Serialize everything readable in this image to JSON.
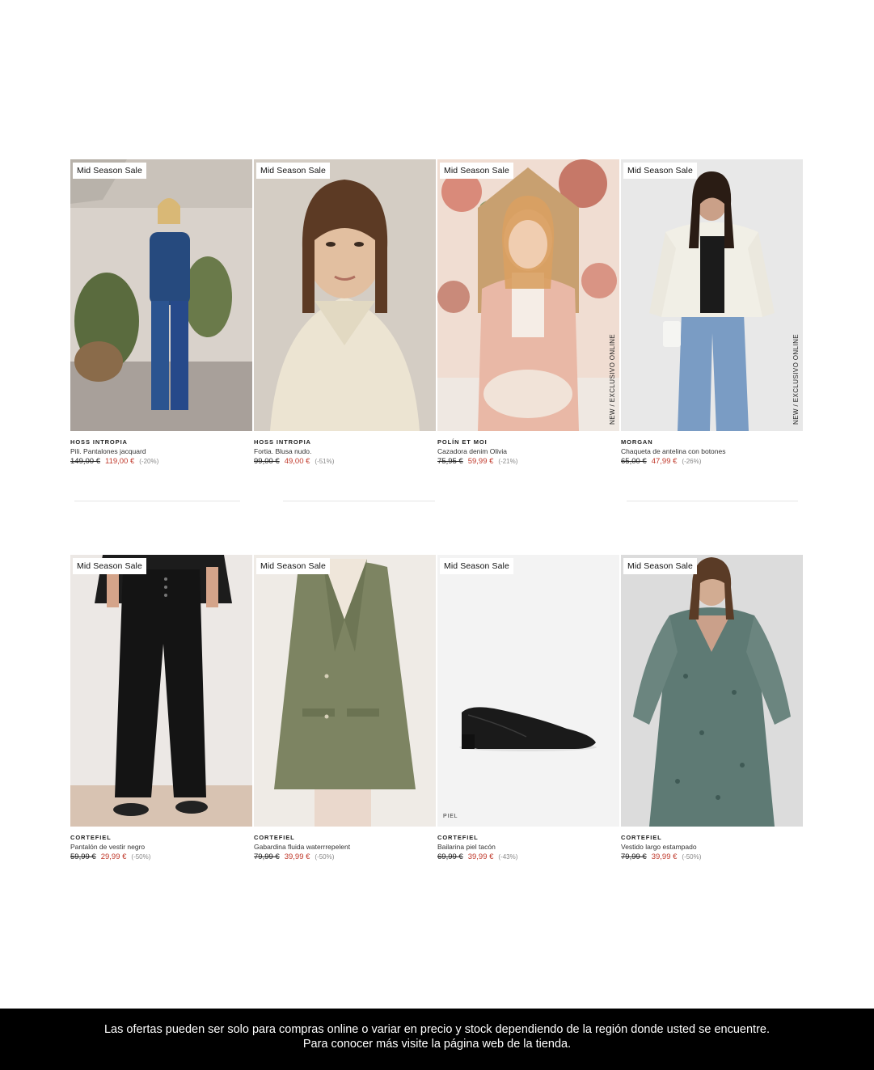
{
  "colors": {
    "sale_price": "#c0392b",
    "discount": "#888888",
    "footer_bg": "#000000",
    "footer_text": "#ffffff"
  },
  "rows": [
    {
      "products": [
        {
          "badge": "Mid Season Sale",
          "brand": "HOSS INTROPIA",
          "name": "Pili. Pantalones jacquard",
          "old_price": "149,00 €",
          "new_price": "119,00 €",
          "discount": "(-20%)",
          "tag": ""
        },
        {
          "badge": "Mid Season Sale",
          "brand": "HOSS INTROPIA",
          "name": "Fortia. Blusa nudo.",
          "old_price": "99,00 €",
          "new_price": "49,00 €",
          "discount": "(-51%)",
          "tag": ""
        },
        {
          "badge": "Mid Season Sale",
          "brand": "POLÍN ET MOI",
          "name": "Cazadora denim Olivia",
          "old_price": "75,95 €",
          "new_price": "59,99 €",
          "discount": "(-21%)",
          "tag": "NEW  /  EXCLUSIVO ONLINE"
        },
        {
          "badge": "Mid Season Sale",
          "brand": "MORGAN",
          "name": "Chaqueta de antelina con botones",
          "old_price": "65,00 €",
          "new_price": "47,99 €",
          "discount": "(-26%)",
          "tag": "NEW  /  EXCLUSIVO ONLINE"
        }
      ]
    },
    {
      "products": [
        {
          "badge": "Mid Season Sale",
          "brand": "CORTEFIEL",
          "name": "Pantalón de vestir negro",
          "old_price": "59,99 €",
          "new_price": "29,99 €",
          "discount": "(-50%)",
          "tag": ""
        },
        {
          "badge": "Mid Season Sale",
          "brand": "CORTEFIEL",
          "name": "Gabardina fluida waterrrepelent",
          "old_price": "79,99 €",
          "new_price": "39,99 €",
          "discount": "(-50%)",
          "tag": ""
        },
        {
          "badge": "Mid Season Sale",
          "brand": "CORTEFIEL",
          "name": "Bailarina piel tacón",
          "old_price": "69,99 €",
          "new_price": "39,99 €",
          "discount": "(-43%)",
          "tag": "PIEL"
        },
        {
          "badge": "Mid Season Sale",
          "brand": "CORTEFIEL",
          "name": "Vestido largo estampado",
          "old_price": "79,99 €",
          "new_price": "39,99 €",
          "discount": "(-50%)",
          "tag": ""
        }
      ]
    }
  ],
  "footer": {
    "line1": "Las ofertas pueden ser solo para compras online o variar en precio y stock dependiendo de la región donde usted se encuentre.",
    "line2": "Para conocer más visite la página web de la tienda."
  }
}
